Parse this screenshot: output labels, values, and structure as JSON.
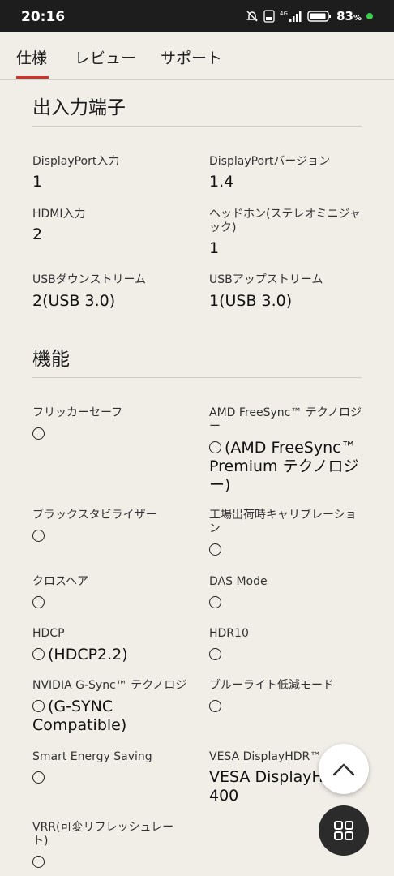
{
  "status": {
    "time": "20:16",
    "battery": "83"
  },
  "tabs": [
    "仕様",
    "レビュー",
    "サポート"
  ],
  "sections": {
    "ports": "出入力端子",
    "features": "機能"
  },
  "specs": {
    "dp_in_label": "DisplayPort入力",
    "dp_in_value": "1",
    "dp_ver_label": "DisplayPortバージョン",
    "dp_ver_value": "1.4",
    "hdmi_label": "HDMI入力",
    "hdmi_value": "2",
    "headphone_label": "ヘッドホン(ステレオミニジャック)",
    "headphone_value": "1",
    "usb_down_label": "USBダウンストリーム",
    "usb_down_value": "2(USB 3.0)",
    "usb_up_label": "USBアップストリーム",
    "usb_up_value": "1(USB 3.0)",
    "flicker_label": "フリッカーセーフ",
    "freesync_label": "AMD FreeSync™ テクノロジー",
    "freesync_value": "(AMD FreeSync™ Premium テクノロジー)",
    "black_label": "ブラックスタビライザー",
    "calib_label": "工場出荷時キャリブレーション",
    "crosshair_label": "クロスヘア",
    "das_label": "DAS Mode",
    "hdcp_label": "HDCP",
    "hdcp_value": "(HDCP2.2)",
    "hdr10_label": "HDR10",
    "gsync_label": "NVIDIA G-Sync™ テクノロジ",
    "gsync_value": "(G-SYNC Compatible)",
    "bluelight_label": "ブルーライト低減モード",
    "ses_label": "Smart Energy Saving",
    "vesa_label": "VESA DisplayHDR™",
    "vesa_value": "VESA DisplayHDR 400",
    "vrr_label": "VRR(可変リフレッシュレート)"
  }
}
